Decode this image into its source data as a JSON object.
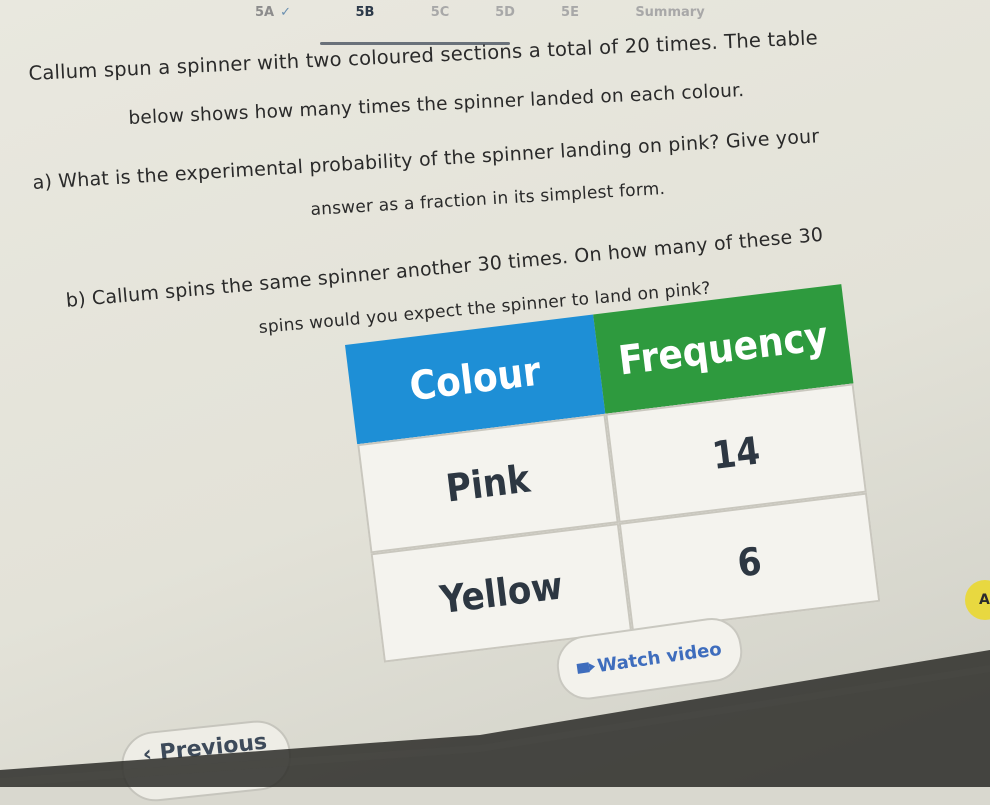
{
  "tabs": [
    {
      "label": "5A",
      "state": "done",
      "check": "✓"
    },
    {
      "label": "5B",
      "state": "active"
    },
    {
      "label": "5C",
      "state": "inactive"
    },
    {
      "label": "5D",
      "state": "inactive"
    },
    {
      "label": "5E",
      "state": "inactive"
    },
    {
      "label": "Summary",
      "state": "inactive"
    }
  ],
  "question": {
    "intro_line1": "Callum spun a spinner with two coloured sections a total of 20 times. The table",
    "intro_line2": "below shows how many times the spinner landed on each colour.",
    "a_line1": "a) What is the experimental probability of the spinner landing on pink? Give your",
    "a_line2": "answer as a fraction in its simplest form.",
    "b_line1": "b) Callum spins the same spinner another 30 times. On how many of these 30",
    "b_line2": "spins would you expect the spinner to land on pink?"
  },
  "table": {
    "headers": [
      "Colour",
      "Frequency"
    ],
    "rows": [
      {
        "colour": "Pink",
        "frequency": "14"
      },
      {
        "colour": "Yellow",
        "frequency": "6"
      }
    ],
    "header_colors": {
      "colour": "#1e8fd6",
      "frequency": "#2e9a3e"
    }
  },
  "buttons": {
    "watch_video": "Watch video",
    "watch_video_icon": "video-icon",
    "previous": "Previous",
    "previous_icon": "chevron-left-icon"
  },
  "badge": {
    "label": "A"
  }
}
